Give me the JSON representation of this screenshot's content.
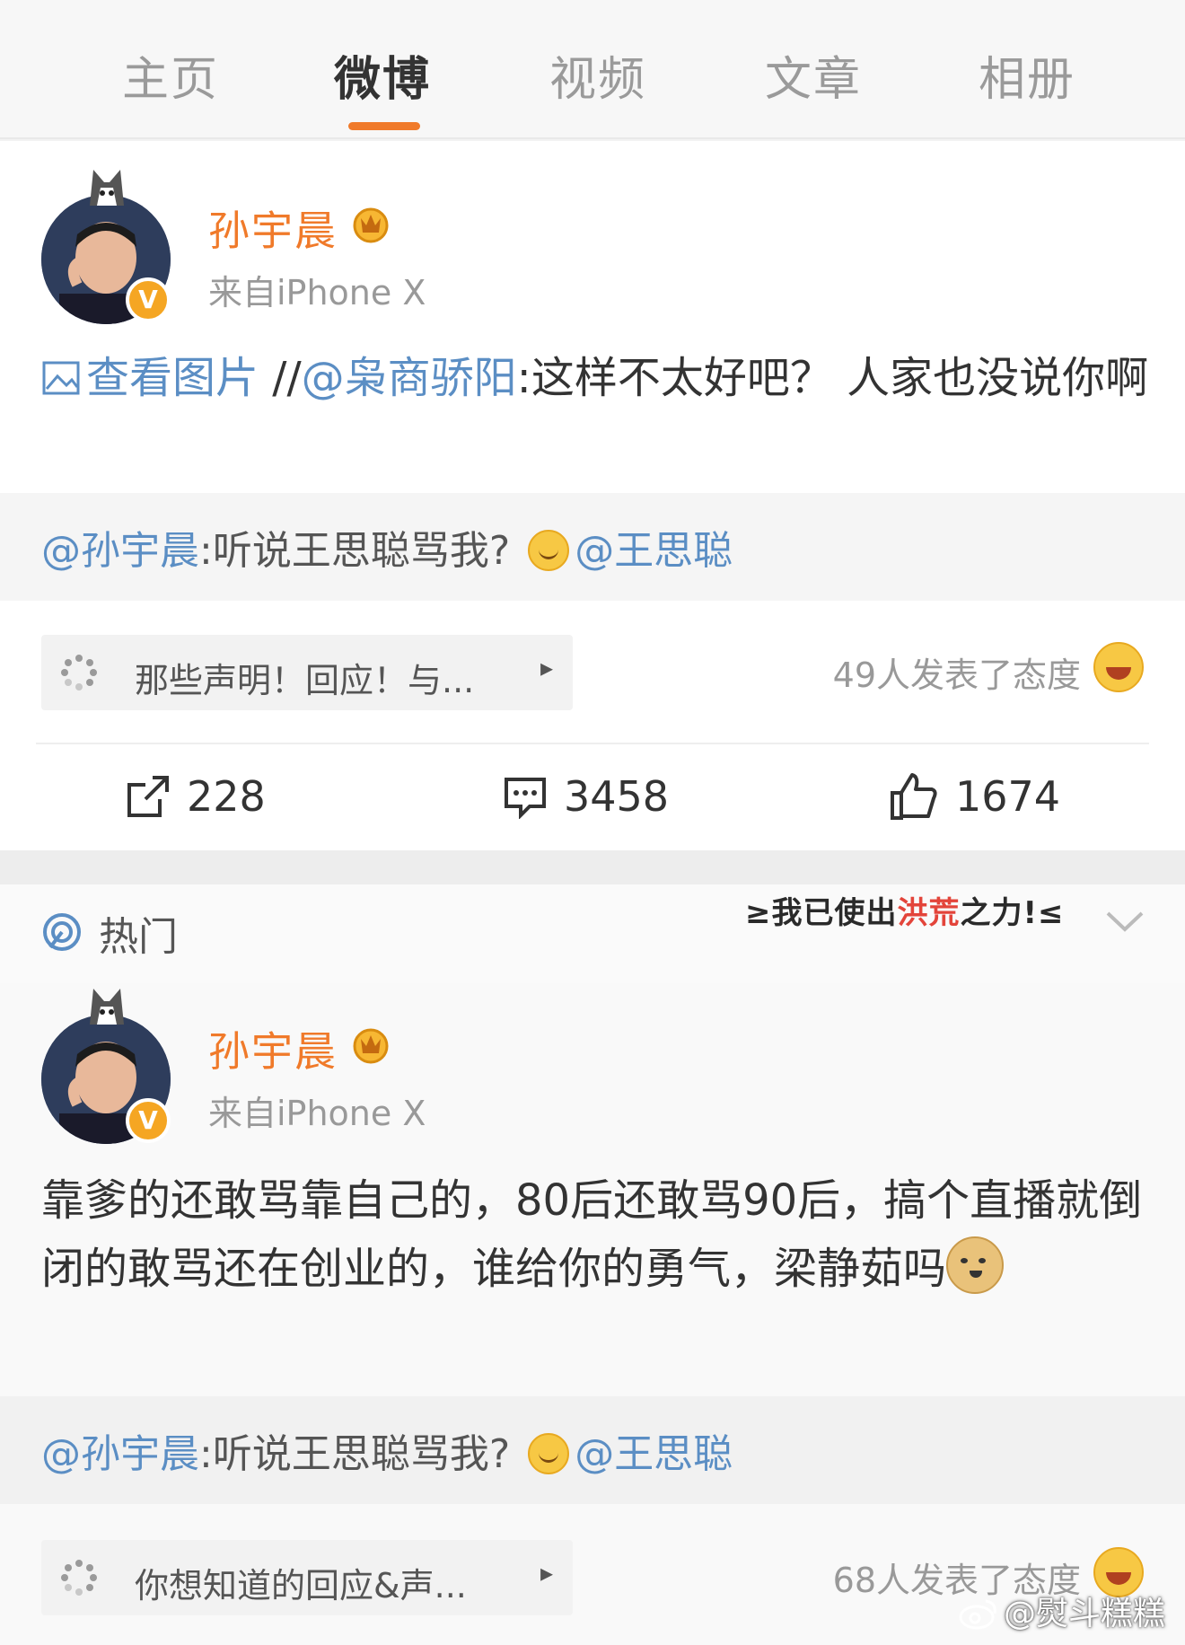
{
  "tabs": [
    {
      "label": "主页"
    },
    {
      "label": "微博"
    },
    {
      "label": "视频"
    },
    {
      "label": "文章"
    },
    {
      "label": "相册"
    }
  ],
  "post1": {
    "username": "孙宇晨",
    "source": "来自iPhone X",
    "badge": "V",
    "view_pic": "查看图片",
    "repost_prefix": " //",
    "mention": "@枭商骄阳",
    "text": ":这样不太好吧？  人家也没说你啊",
    "quote_mention": "@孙宇晨",
    "quote_text": ":听说王思聪骂我?",
    "quote_target": "@王思聪",
    "topic": "那些声明！回应！与...",
    "topic_arrow": "▸",
    "attitude": "49人发表了态度",
    "reposts": "228",
    "comments": "3458",
    "likes": "1674"
  },
  "hot": {
    "label": "热门",
    "banner_prefix": "≥我已使出",
    "banner_highlight": "洪荒",
    "banner_suffix": "之力!≤"
  },
  "post2": {
    "username": "孙宇晨",
    "source": "来自iPhone X",
    "badge": "V",
    "text": "靠爹的还敢骂靠自己的，80后还敢骂90后，搞个直播就倒闭的敢骂还在创业的，谁给你的勇气，梁静茹吗",
    "quote_mention": "@孙宇晨",
    "quote_text": ":听说王思聪骂我?",
    "quote_target": "@王思聪",
    "topic": "你想知道的回应&声...",
    "topic_arrow": "▸",
    "attitude": "68人发表了态度"
  },
  "watermark": "@熨斗糕糕",
  "colors": {
    "accent": "#f07a2a",
    "link": "#5b8ec4",
    "muted": "#999999"
  }
}
